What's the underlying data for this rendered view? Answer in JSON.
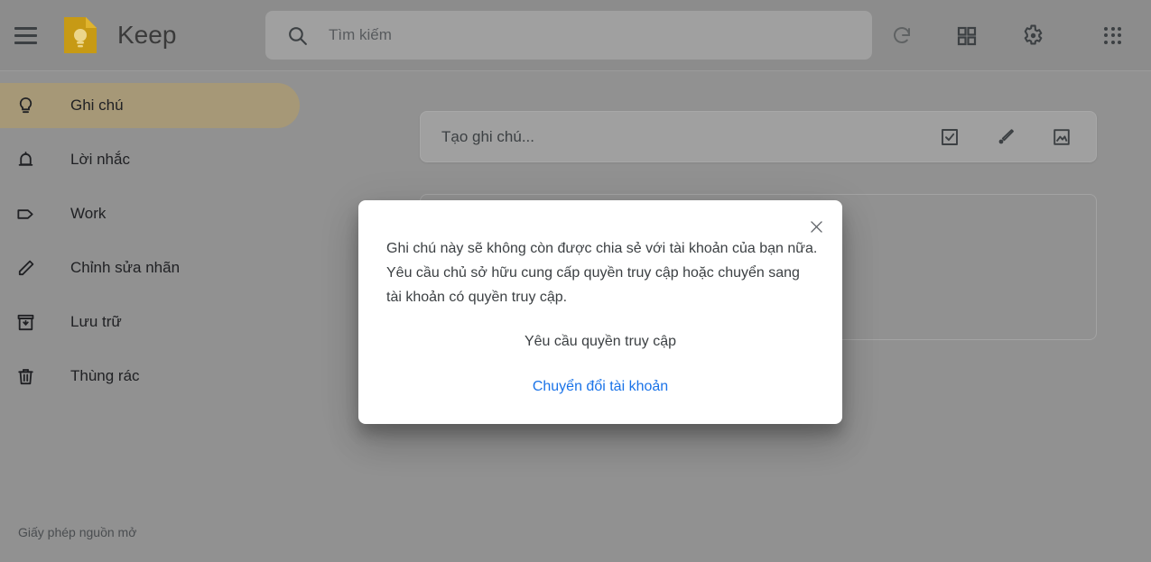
{
  "app": {
    "title": "Keep",
    "logo_color": "#d4a017",
    "accent_link_color": "#1a73e8",
    "active_nav_color": "#a69877"
  },
  "header": {
    "menu_icon": "hamburger-menu-icon",
    "logo_icon": "keep-logo-icon",
    "title": "Keep",
    "search": {
      "icon": "search-icon",
      "placeholder": "Tìm kiếm",
      "value": ""
    },
    "actions": [
      {
        "name": "refresh-button",
        "icon": "refresh-icon",
        "disabled": true
      },
      {
        "name": "list-view-button",
        "icon": "grid-view-icon",
        "disabled": false
      },
      {
        "name": "settings-button",
        "icon": "gear-icon",
        "disabled": false
      },
      {
        "name": "apps-grid-button",
        "icon": "apps-grid-icon",
        "disabled": false
      }
    ]
  },
  "sidebar": {
    "items": [
      {
        "label": "Ghi chú",
        "icon": "lightbulb-icon",
        "active": true
      },
      {
        "label": "Lời nhắc",
        "icon": "bell-icon",
        "active": false
      },
      {
        "label": "Work",
        "icon": "label-tag-icon",
        "active": false
      },
      {
        "label": "Chỉnh sửa nhãn",
        "icon": "pencil-icon",
        "active": false
      },
      {
        "label": "Lưu trữ",
        "icon": "archive-icon",
        "active": false
      },
      {
        "label": "Thùng rác",
        "icon": "trash-icon",
        "active": false
      }
    ],
    "footer_link": "Giấy phép nguồn mở"
  },
  "main": {
    "composer": {
      "placeholder": "Tạo ghi chú...",
      "actions": [
        {
          "name": "new-list-button",
          "icon": "checkbox-icon"
        },
        {
          "name": "new-drawing-button",
          "icon": "brush-icon"
        },
        {
          "name": "new-image-button",
          "icon": "image-icon"
        }
      ]
    }
  },
  "dialog": {
    "close_icon": "close-icon",
    "message": "Ghi chú này sẽ không còn được chia sẻ với tài khoản của bạn nữa. Yêu cầu chủ sở hữu cung cấp quyền truy cập hoặc chuyển sang tài khoản có quyền truy cập.",
    "primary_action": "Yêu cầu quyền truy cập",
    "secondary_action": "Chuyển đổi tài khoản"
  }
}
